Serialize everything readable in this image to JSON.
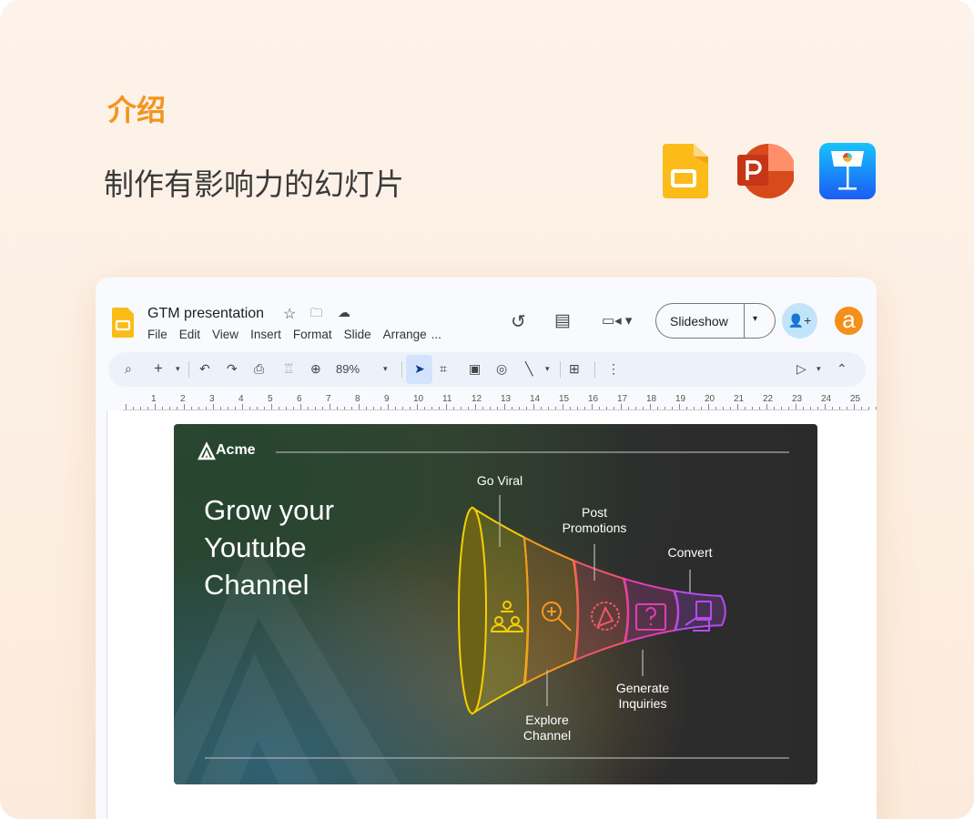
{
  "header": {
    "title": "介绍",
    "subtitle": "制作有影响力的幻灯片"
  },
  "app_icons": [
    "google-slides-icon",
    "powerpoint-icon",
    "keynote-icon"
  ],
  "doc": {
    "title": "GTM presentation",
    "menu": [
      "File",
      "Edit",
      "View",
      "Insert",
      "Format",
      "Slide",
      "Arrange",
      "..."
    ],
    "slideshow_label": "Slideshow",
    "avatar_letter": "a",
    "zoom": "89%"
  },
  "ruler": [
    "1",
    "2",
    "3",
    "4",
    "5",
    "6",
    "7",
    "8",
    "9",
    "10",
    "11",
    "12",
    "13",
    "14",
    "15",
    "16",
    "17",
    "18",
    "19",
    "20",
    "21",
    "22",
    "23",
    "24",
    "25"
  ],
  "slide": {
    "brand": "Acme",
    "headline": [
      "Grow your",
      "Youtube",
      "Channel"
    ],
    "stages": [
      "Go Viral",
      "Explore Channel",
      "Post Promotions",
      "Generate Inquiries",
      "Convert"
    ],
    "labels": {
      "go_viral": "Go Viral",
      "explore1": "Explore",
      "explore2": "Channel",
      "post1": "Post",
      "post2": "Promotions",
      "gen1": "Generate",
      "gen2": "Inquiries",
      "convert": "Convert"
    }
  },
  "colors": {
    "accent": "#f3941d",
    "funnel": [
      "#f5d000",
      "#f79a1e",
      "#f2566a",
      "#e23fb6",
      "#b44cf0"
    ]
  }
}
